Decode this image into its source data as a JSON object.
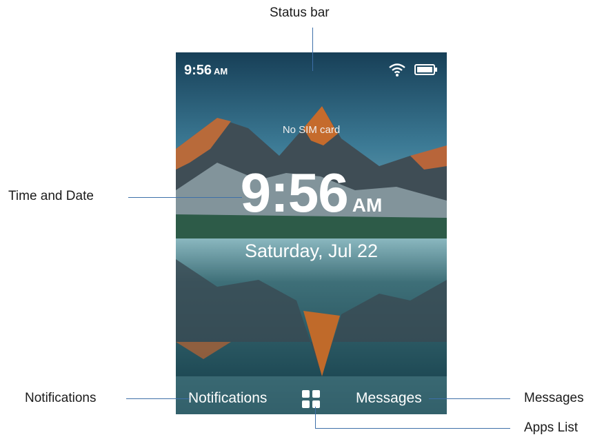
{
  "callouts": {
    "status_bar": "Status bar",
    "time_and_date": "Time and Date",
    "notifications": "Notifications",
    "messages": "Messages",
    "apps_list": "Apps List"
  },
  "status_bar": {
    "time": "9:56",
    "ampm": "AM",
    "icons": [
      "wifi-icon",
      "battery-icon"
    ]
  },
  "lock_screen": {
    "carrier_status": "No SIM card",
    "time": "9:56",
    "ampm": "AM",
    "date": "Saturday, Jul 22"
  },
  "bottom_bar": {
    "left_label": "Notifications",
    "center_icon": "apps-grid-icon",
    "right_label": "Messages"
  }
}
